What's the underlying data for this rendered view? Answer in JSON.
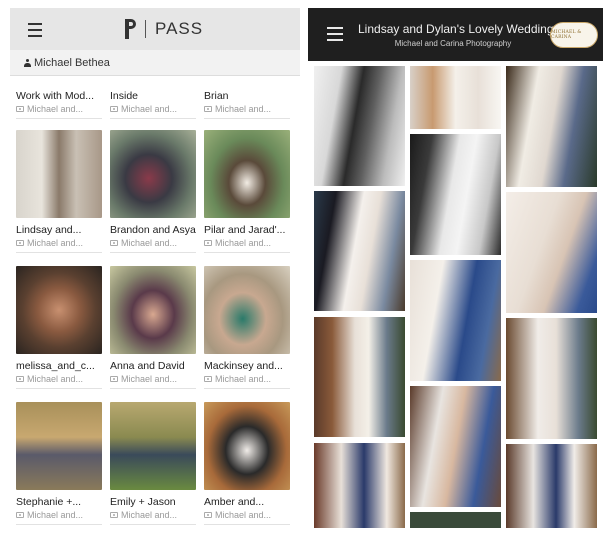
{
  "left_app": {
    "logo_text": "PASS",
    "user_name": "Michael Bethea",
    "albums": [
      {
        "title": "Work with Mod...",
        "meta": "Michael and..."
      },
      {
        "title": "Inside",
        "meta": "Michael and..."
      },
      {
        "title": "Brian",
        "meta": "Michael and..."
      },
      {
        "title": "Lindsay and...",
        "meta": "Michael and..."
      },
      {
        "title": "Brandon and Asya",
        "meta": "Michael and..."
      },
      {
        "title": "Pilar and Jarad'...",
        "meta": "Michael and..."
      },
      {
        "title": "melissa_and_c...",
        "meta": "Michael and..."
      },
      {
        "title": "Anna and David",
        "meta": "Michael and..."
      },
      {
        "title": "Mackinsey and...",
        "meta": "Michael and..."
      },
      {
        "title": "Stephanie +...",
        "meta": "Michael and..."
      },
      {
        "title": "Emily + Jason",
        "meta": "Michael and..."
      },
      {
        "title": "Amber and...",
        "meta": "Michael and..."
      }
    ],
    "icons": {
      "menu": "menu-icon",
      "user": "person-icon",
      "camera": "camera-icon"
    }
  },
  "right_app": {
    "title": "Lindsay and Dylan's Lovely Wedding",
    "subtitle": "Michael and Carina Photography",
    "badge_text": "MICHAEL & CARINA",
    "icons": {
      "menu": "menu-icon"
    }
  }
}
